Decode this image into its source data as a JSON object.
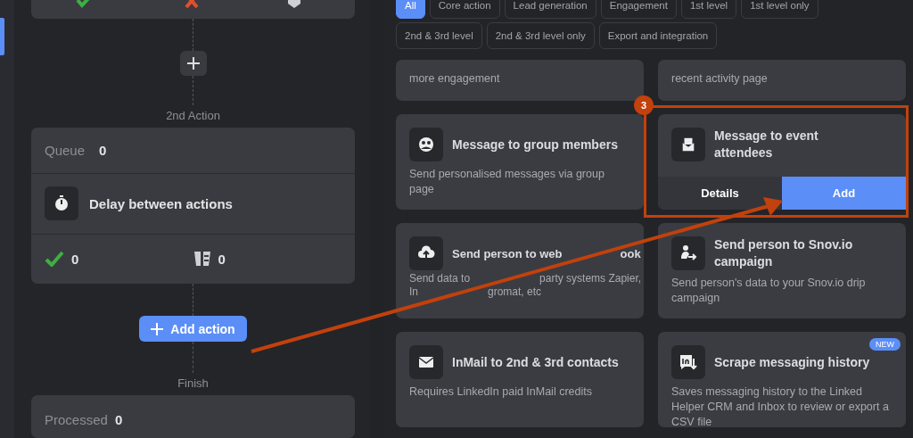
{
  "flow": {
    "step_label": "2nd Action",
    "queue_label": "Queue",
    "queue": "0",
    "action_title": "Delay between actions",
    "succeeded": "0",
    "skipped": "0",
    "add_button": "Add action",
    "finish_label": "Finish",
    "processed_label": "Processed",
    "processed": "0"
  },
  "filters": [
    {
      "label": "All",
      "selected": true
    },
    {
      "label": "Core action",
      "selected": false
    },
    {
      "label": "Lead generation",
      "selected": false
    },
    {
      "label": "Engagement",
      "selected": false
    },
    {
      "label": "1st level",
      "selected": false
    },
    {
      "label": "1st level only",
      "selected": false
    },
    {
      "label": "2nd & 3rd level",
      "selected": false
    },
    {
      "label": "2nd & 3rd level only",
      "selected": false
    },
    {
      "label": "Export and integration",
      "selected": false
    }
  ],
  "actions": [
    {
      "kind": "partial",
      "description": "more engagement"
    },
    {
      "kind": "partial",
      "description": "recent activity page"
    },
    {
      "kind": "action",
      "title": "Message to group members",
      "description": "Send personalised messages via group page"
    },
    {
      "kind": "selected",
      "title": "Message to event attendees",
      "details_button": "Details",
      "add_button": "Add",
      "callout": "3"
    },
    {
      "kind": "covered",
      "title_parts": [
        "Send person to web",
        "ook"
      ],
      "description_lines": [
        [
          "Send data to",
          "party systems Zapier,"
        ],
        [
          "In",
          "gromat, etc"
        ]
      ]
    },
    {
      "kind": "action",
      "title": "Send person to Snov.io campaign",
      "description": "Send person's data to your Snov.io drip campaign"
    },
    {
      "kind": "action",
      "title": "InMail to 2nd & 3rd contacts",
      "description": "Requires LinkedIn paid InMail credits"
    },
    {
      "kind": "action",
      "title": "Scrape messaging history",
      "description": "Saves messaging history to the Linked Helper CRM and Inbox to review or export a CSV file",
      "badge": "NEW"
    }
  ]
}
